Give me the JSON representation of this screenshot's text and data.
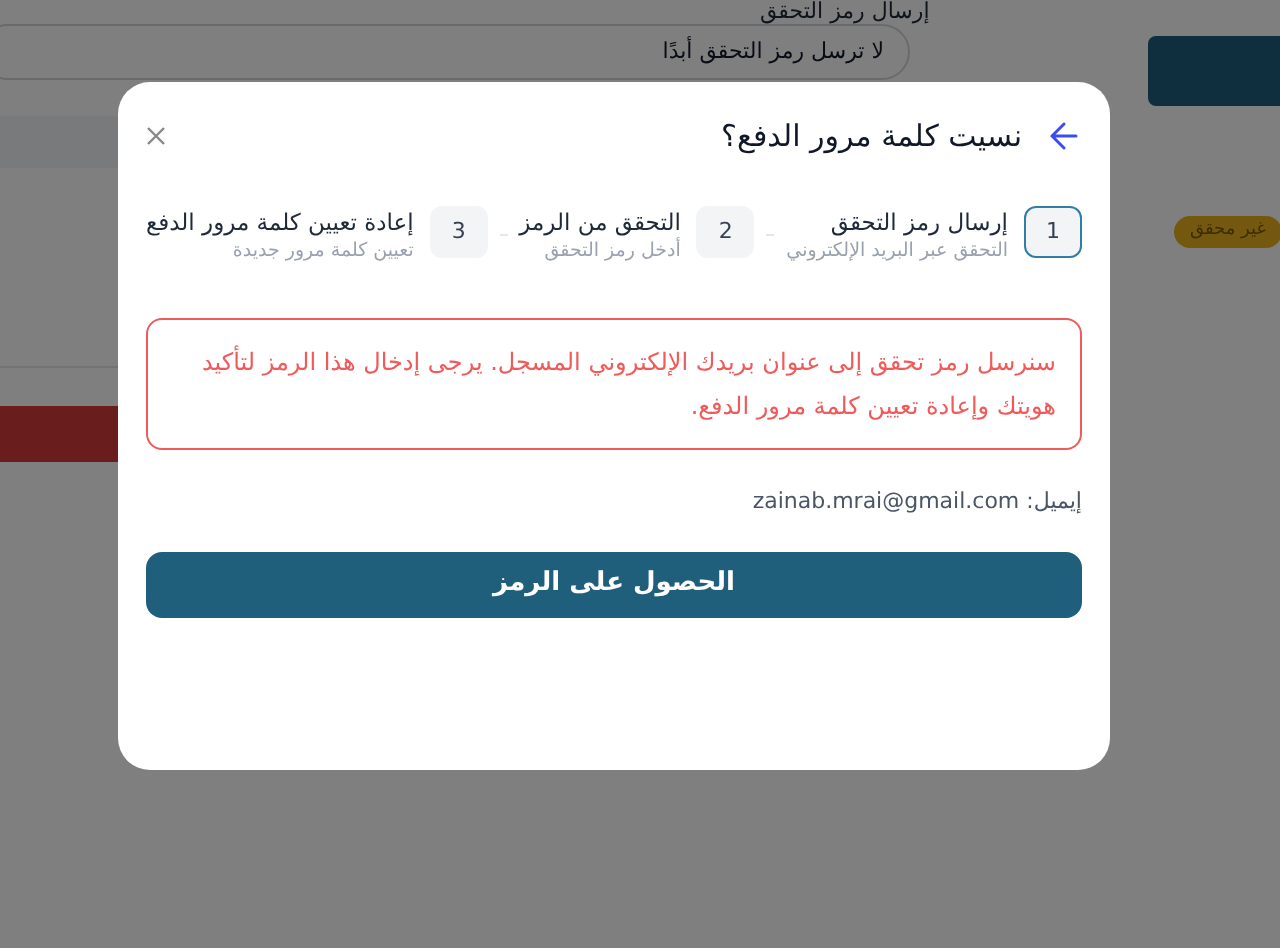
{
  "background": {
    "field_label": "إرسال رمز التحقق",
    "field_value": "لا ترسل رمز التحقق أبدًا",
    "badge": "غير محقق"
  },
  "dialog": {
    "title": "نسيت كلمة مرور الدفع؟",
    "steps": [
      {
        "number": "1",
        "title": "إرسال رمز التحقق",
        "subtitle": "التحقق عبر البريد الإلكتروني",
        "selected": true
      },
      {
        "number": "2",
        "title": "التحقق من الرمز",
        "subtitle": "أدخل رمز التحقق",
        "selected": false
      },
      {
        "number": "3",
        "title": "إعادة تعيين كلمة مرور الدفع",
        "subtitle": "تعيين كلمة مرور جديدة",
        "selected": false
      }
    ],
    "notice": "سنرسل رمز تحقق إلى عنوان بريدك الإلكتروني المسجل. يرجى إدخال هذا الرمز لتأكيد هويتك وإعادة تعيين كلمة مرور الدفع.",
    "email": "إيميل: zainab.mrai@gmail.com",
    "button": "الحصول على الرمز"
  }
}
